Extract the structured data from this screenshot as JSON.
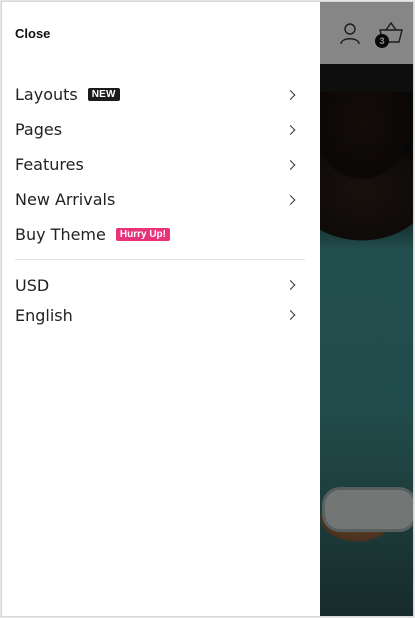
{
  "drawer": {
    "close_label": "Close"
  },
  "menu": {
    "items": [
      {
        "label": "Layouts",
        "tag": "NEW"
      },
      {
        "label": "Pages"
      },
      {
        "label": "Features"
      },
      {
        "label": "New Arrivals"
      },
      {
        "label": "Buy Theme",
        "tag": "Hurry Up!"
      }
    ]
  },
  "settings": {
    "currency": "USD",
    "language": "English"
  },
  "header": {
    "cart_count": "3"
  },
  "colors": {
    "hurry_tag": "#e8327a",
    "new_tag": "#1a1a1a",
    "overlay": "rgba(0,0,0,0.45)"
  },
  "icons": [
    "user-icon",
    "cart-icon",
    "chevron-right-icon"
  ]
}
